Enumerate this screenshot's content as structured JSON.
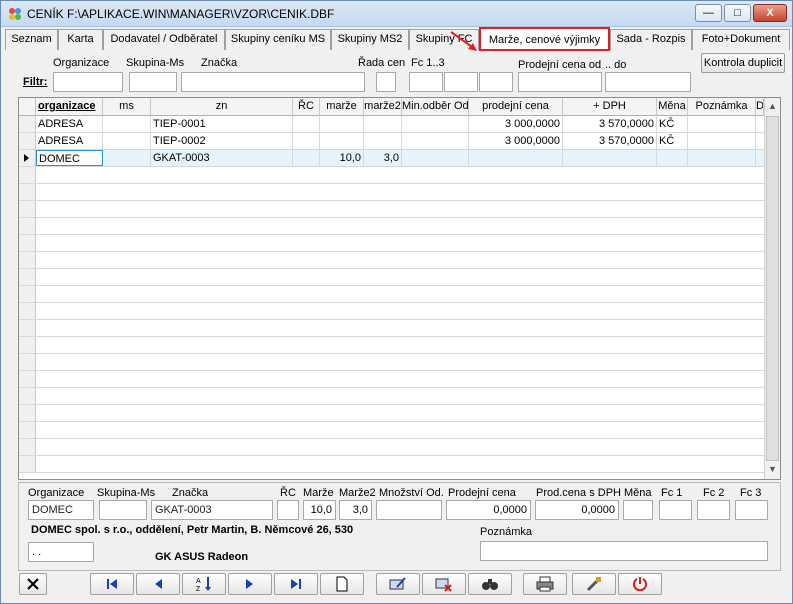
{
  "window": {
    "title": "CENÍK F:\\APLIKACE.WIN\\MANAGER\\VZOR\\CENIK.DBF",
    "minimize_label": "—",
    "maximize_label": "□",
    "close_label": "X"
  },
  "tabs": [
    {
      "label": "Seznam"
    },
    {
      "label": "Karta"
    },
    {
      "label": "Dodavatel / Odběratel"
    },
    {
      "label": "Skupiny ceníku MS"
    },
    {
      "label": "Skupiny MS2"
    },
    {
      "label": "Skupiny FC"
    },
    {
      "label": "Marže, cenové výjimky",
      "active": true
    },
    {
      "label": "Sada - Rozpis"
    },
    {
      "label": "Foto+Dokument"
    }
  ],
  "filter": {
    "label": "Filtr:",
    "organizace_label": "Organizace",
    "skupina_label": "Skupina-Ms",
    "znacka_label": "Značka",
    "rada_label": "Řada cen",
    "fc_label": "Fc 1..3",
    "prodejni_od_label": "Prodejní cena od",
    "do_label": ".. do",
    "kontrola_button": "Kontrola duplicit"
  },
  "grid": {
    "columns": [
      "organizace",
      "ms",
      "zn",
      "ŘC",
      "marže",
      "marže2",
      "Min.odběr Od",
      "prodejní cena",
      "+ DPH",
      "Měna",
      "Poznámka",
      "D"
    ],
    "rows": [
      {
        "org": "ADRESA",
        "ms": "",
        "zn": "TIEP-0001",
        "rc": "",
        "marze": "",
        "marze2": "",
        "min": "",
        "cena": "3 000,0000",
        "dph": "3 570,0000",
        "mena": "KČ",
        "pozn": ""
      },
      {
        "org": "ADRESA",
        "ms": "",
        "zn": "TIEP-0002",
        "rc": "",
        "marze": "",
        "marze2": "",
        "min": "",
        "cena": "3 000,0000",
        "dph": "3 570,0000",
        "mena": "KČ",
        "pozn": ""
      },
      {
        "org": "DOMEC",
        "ms": "",
        "zn": "GKAT-0003",
        "rc": "",
        "marze": "10,0",
        "marze2": "3,0",
        "min": "",
        "cena": "",
        "dph": "",
        "mena": "",
        "pozn": ""
      }
    ]
  },
  "detail": {
    "labels": {
      "organizace": "Organizace",
      "skupina": "Skupina-Ms",
      "znacka": "Značka",
      "rc": "ŘC",
      "marze": "Marže",
      "marze2": "Marže2",
      "mnozstvi": "Množství Od.",
      "prodejni": "Prodejní cena",
      "prod_dph": "Prod.cena s DPH",
      "mena": "Měna",
      "fc1": "Fc 1",
      "fc2": "Fc 2",
      "fc3": "Fc 3",
      "poznamka": "Poznámka"
    },
    "values": {
      "organizace": "DOMEC",
      "skupina": "",
      "znacka": "GKAT-0003",
      "rc": "",
      "marze": "10,0",
      "marze2": "3,0",
      "mnozstvi": "",
      "prodejni": "0,0000",
      "prod_dph": "0,0000",
      "mena": "",
      "fc1": "",
      "fc2": "",
      "fc3": "",
      "poznamka": "",
      "date": ".  .",
      "address": "DOMEC spol. s r.o., oddělení, Petr Martin, B. Němcové 26, 530",
      "product": "GK ASUS Radeon"
    }
  },
  "colors": {
    "accent": "#e02020",
    "selection": "#2a8fd6"
  }
}
